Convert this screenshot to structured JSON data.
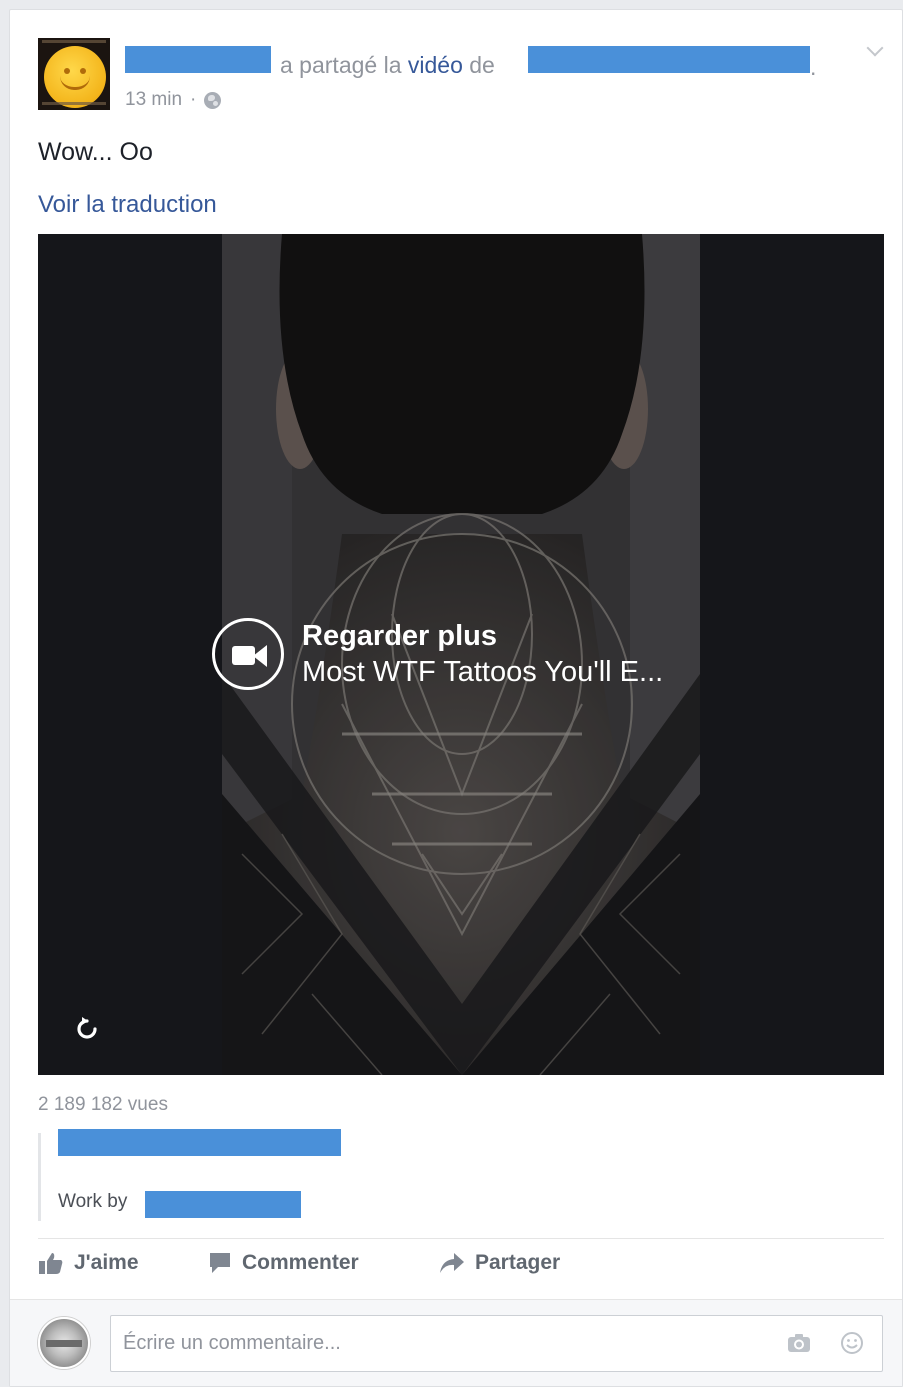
{
  "post": {
    "shared_verb": "a partagé la",
    "video_link": "vidéo",
    "of_word": "de",
    "headline_end": ".",
    "time": "13 min",
    "separator": "·",
    "text": "Wow... Oo",
    "translate": "Voir la traduction"
  },
  "video": {
    "watch_more": "Regarder plus",
    "video_title": "Most WTF Tattoos You'll E...",
    "views": "2 189 182 vues"
  },
  "description": {
    "work_by": "Work by"
  },
  "actions": {
    "like": "J'aime",
    "comment": "Commenter",
    "share": "Partager"
  },
  "composer": {
    "placeholder": "Écrire un commentaire..."
  },
  "colors": {
    "redaction": "#4a90d9",
    "link": "#365899",
    "muted": "#90949c"
  },
  "icons": [
    "chevron-down-icon",
    "globe-icon",
    "video-camera-icon",
    "replay-icon",
    "like-icon",
    "comment-icon",
    "share-icon",
    "camera-icon",
    "smiley-icon"
  ]
}
